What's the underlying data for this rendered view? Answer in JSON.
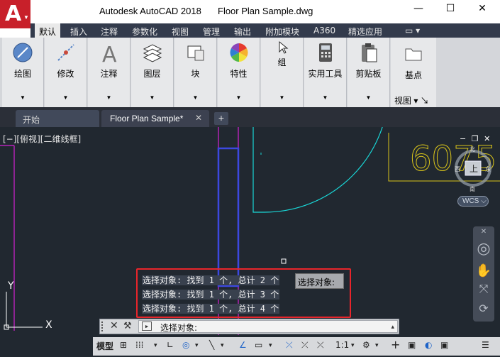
{
  "app": {
    "title": "Autodesk AutoCAD 2018",
    "filename": "Floor Plan Sample.dwg",
    "logo_letter": "A",
    "logo_color": "#c8202a"
  },
  "window_controls": {
    "minimize": "—",
    "maximize": "☐",
    "close": "✕"
  },
  "ribbon_tabs": [
    "默认",
    "插入",
    "注释",
    "参数化",
    "视图",
    "管理",
    "输出",
    "附加模块",
    "A360",
    "精选应用"
  ],
  "ribbon_tab_extra": "▭ ▾",
  "ribbon_panels": [
    {
      "label": "绘图",
      "icon": "draw-icon"
    },
    {
      "label": "修改",
      "icon": "modify-icon"
    },
    {
      "label": "注释",
      "icon": "annotation-icon"
    },
    {
      "label": "图层",
      "icon": "layers-icon"
    },
    {
      "label": "块",
      "icon": "block-icon"
    },
    {
      "label": "特性",
      "icon": "properties-icon"
    },
    {
      "label": "组",
      "icon": "group-icon"
    },
    {
      "label": "实用工具",
      "icon": "utilities-icon"
    },
    {
      "label": "剪贴板",
      "icon": "clipboard-icon"
    },
    {
      "label": "基点",
      "icon": "base-point-icon",
      "footer": "视图"
    }
  ],
  "doc_tabs": {
    "start": "开始",
    "file": "Floor Plan Sample*",
    "close": "✕",
    "add": "+"
  },
  "viewport": {
    "label": "[−][俯视][二维线框]",
    "controls": "− ❐ ✕",
    "wcs": "WCS ⌵",
    "cube_face": "上",
    "compass": {
      "n": "北",
      "s": "南",
      "e": "东",
      "w": "西"
    },
    "dimension_text": "6075",
    "accent_cyan": "#19d7d7",
    "accent_magenta": "#d421d4",
    "accent_blue": "#3c48e0",
    "accent_yellow": "#d9c41a"
  },
  "command_history": [
    "选择对象: 找到 1 个, 总计 2 个",
    "选择对象: 找到 1 个, 总计 3 个",
    "选择对象: 找到 1 个, 总计 4 个"
  ],
  "command_prompt_box": "选择对象:",
  "command_line": {
    "close": "✕",
    "wrench": "🔧",
    "prompt_icon": "▸",
    "prompt_text": "选择对象:",
    "history_toggle": "▴"
  },
  "status_bar": {
    "model": "模型",
    "items": [
      "⊞",
      "⁞⁞⁞",
      "▾",
      "∟",
      "◎",
      "▾",
      "╲",
      "▾",
      "∠",
      "▭",
      "▾",
      "⤫",
      "⤫",
      "⤫",
      "1:1",
      "▾",
      "⚙",
      "▾",
      "+",
      "▣",
      "◐",
      "▣",
      "☰"
    ]
  }
}
